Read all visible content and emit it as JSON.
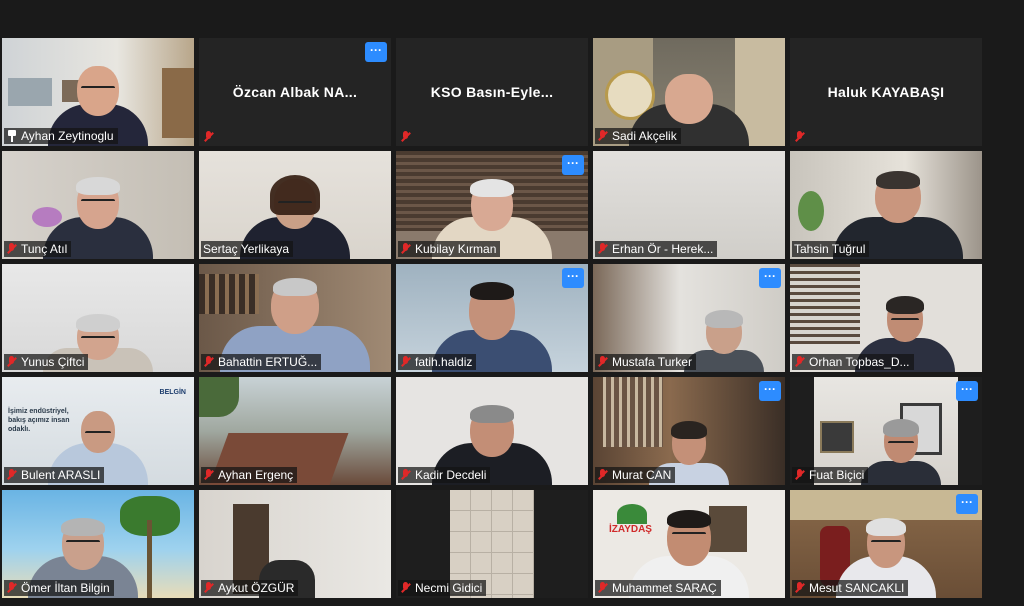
{
  "colors": {
    "background": "#1a1a1a",
    "tile_empty": "#242424",
    "active_speaker_border": "#c9d84a",
    "more_button": "#2d8cff",
    "muted_mic": "#e02828"
  },
  "more_button": {
    "label": "···",
    "icon": "ellipsis-icon"
  },
  "participants": [
    {
      "name": "Ayhan  Zeytinoglu",
      "video": true,
      "pinned": true,
      "muted": false
    },
    {
      "name": "Özcan  Albak  NA...",
      "video": false,
      "muted": true,
      "display_title": "Özcan  Albak  NA..."
    },
    {
      "name": "KSO  Basın-Eyle...",
      "video": false,
      "muted": true,
      "display_title": "KSO  Basın-Eyle..."
    },
    {
      "name": "Sadi Akçelik",
      "video": true,
      "muted": true
    },
    {
      "name": "Haluk KAYABAŞI",
      "video": false,
      "muted": true,
      "display_title": "Haluk KAYABAŞI"
    },
    {
      "name": "Tunç Atıl",
      "video": true,
      "muted": true
    },
    {
      "name": "Sertaç Yerlikaya",
      "video": true,
      "muted": false
    },
    {
      "name": "Kubilay Kırman",
      "video": true,
      "muted": true
    },
    {
      "name": "Erhan Ör - Herek...",
      "video": true,
      "muted": true
    },
    {
      "name": "Tahsin Tuğrul",
      "video": true,
      "muted": false,
      "active_speaker": true
    },
    {
      "name": "Yunus Çiftci",
      "video": true,
      "muted": true
    },
    {
      "name": "Bahattin ERTUĞ...",
      "video": true,
      "muted": true
    },
    {
      "name": "fatih.haldiz",
      "video": true,
      "muted": true
    },
    {
      "name": "Mustafa Turker",
      "video": true,
      "muted": true
    },
    {
      "name": "Orhan Topbas_D...",
      "video": true,
      "muted": true
    },
    {
      "name": "Bulent ARASLI",
      "video": true,
      "muted": true,
      "background_text": "İşimiz endüstriyel, bakış açımız insan odaklı.",
      "background_logo": "BELGİN"
    },
    {
      "name": "Ayhan Ergenç",
      "video": true,
      "muted": true
    },
    {
      "name": "Kadir Decdeli",
      "video": true,
      "muted": true
    },
    {
      "name": "Murat CAN",
      "video": true,
      "muted": true
    },
    {
      "name": "Fuat Biçici",
      "video": true,
      "muted": true
    },
    {
      "name": "Ömer İltan Bilgin",
      "video": true,
      "muted": true
    },
    {
      "name": "Aykut ÖZGÜR",
      "video": true,
      "muted": true
    },
    {
      "name": "Necmi Gidici",
      "video": true,
      "muted": true
    },
    {
      "name": "Muhammet SARAÇ",
      "video": true,
      "muted": true,
      "background_logo": "İZAYDAŞ"
    },
    {
      "name": "Mesut SANCAKLI",
      "video": true,
      "muted": true
    }
  ]
}
